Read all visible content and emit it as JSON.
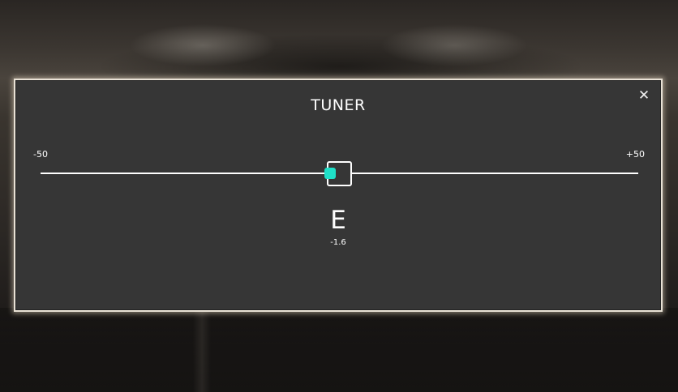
{
  "dialog": {
    "title": "TUNER",
    "close_icon": "close-icon",
    "close_glyph": "✕"
  },
  "tuner": {
    "min_label": "-50",
    "max_label": "+50",
    "min": -50,
    "max": 50,
    "note": "E",
    "cents_label": "-1.6",
    "cents": -1.6,
    "indicator_color": "#1fe0c8"
  }
}
